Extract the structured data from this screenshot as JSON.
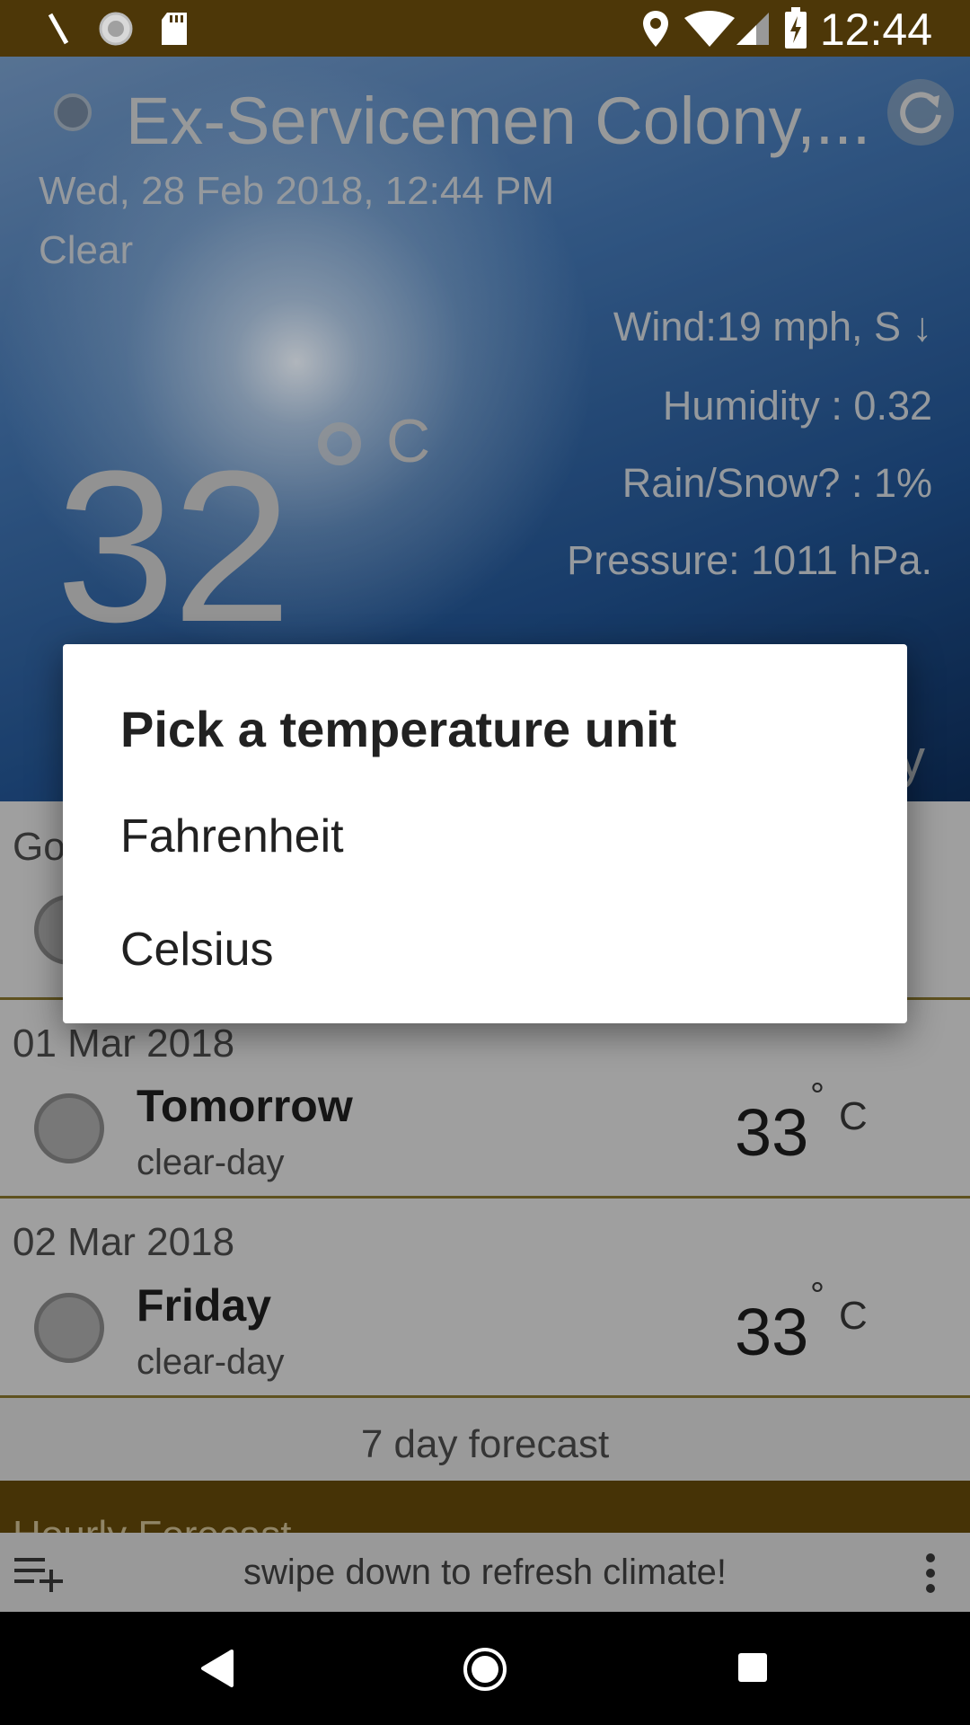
{
  "status_bar": {
    "time": "12:44",
    "left_icons": [
      "pen-icon",
      "spinner-icon",
      "sd-card-icon"
    ],
    "right_icons": [
      "location-icon",
      "wifi-icon",
      "signal-icon",
      "battery-charging-icon"
    ]
  },
  "header": {
    "location": "Ex-Servicemen Colony,...",
    "datetime": "Wed, 28 Feb 2018, 12:44 PM",
    "condition": "Clear",
    "wind": "Wind:19 mph, S ↓",
    "humidity": "Humidity : 0.32",
    "rain": "Rain/Snow? : 1%",
    "pressure": "Pressure: 1011 hPa.",
    "temperature": "32",
    "unit": "C",
    "partial_text": "y"
  },
  "list": {
    "partial_label": "Go",
    "rows": [
      {
        "date": "01 Mar 2018",
        "day": "Tomorrow",
        "condition": "clear-day",
        "temp": "33",
        "deg": "°",
        "unit": "C"
      },
      {
        "date": "02 Mar 2018",
        "day": "Friday",
        "condition": "clear-day",
        "temp": "33",
        "deg": "°",
        "unit": "C"
      }
    ],
    "forecast_button": "7 day forecast",
    "hourly_label": "Hourly Forecast"
  },
  "bottom_bar": {
    "hint": "swipe down to refresh climate!"
  },
  "dialog": {
    "title": "Pick a temperature unit",
    "options": [
      "Fahrenheit",
      "Celsius"
    ]
  },
  "colors": {
    "status_bar": "#4d3708",
    "accent": "#5a4208",
    "dialog_bg": "#ffffff"
  }
}
